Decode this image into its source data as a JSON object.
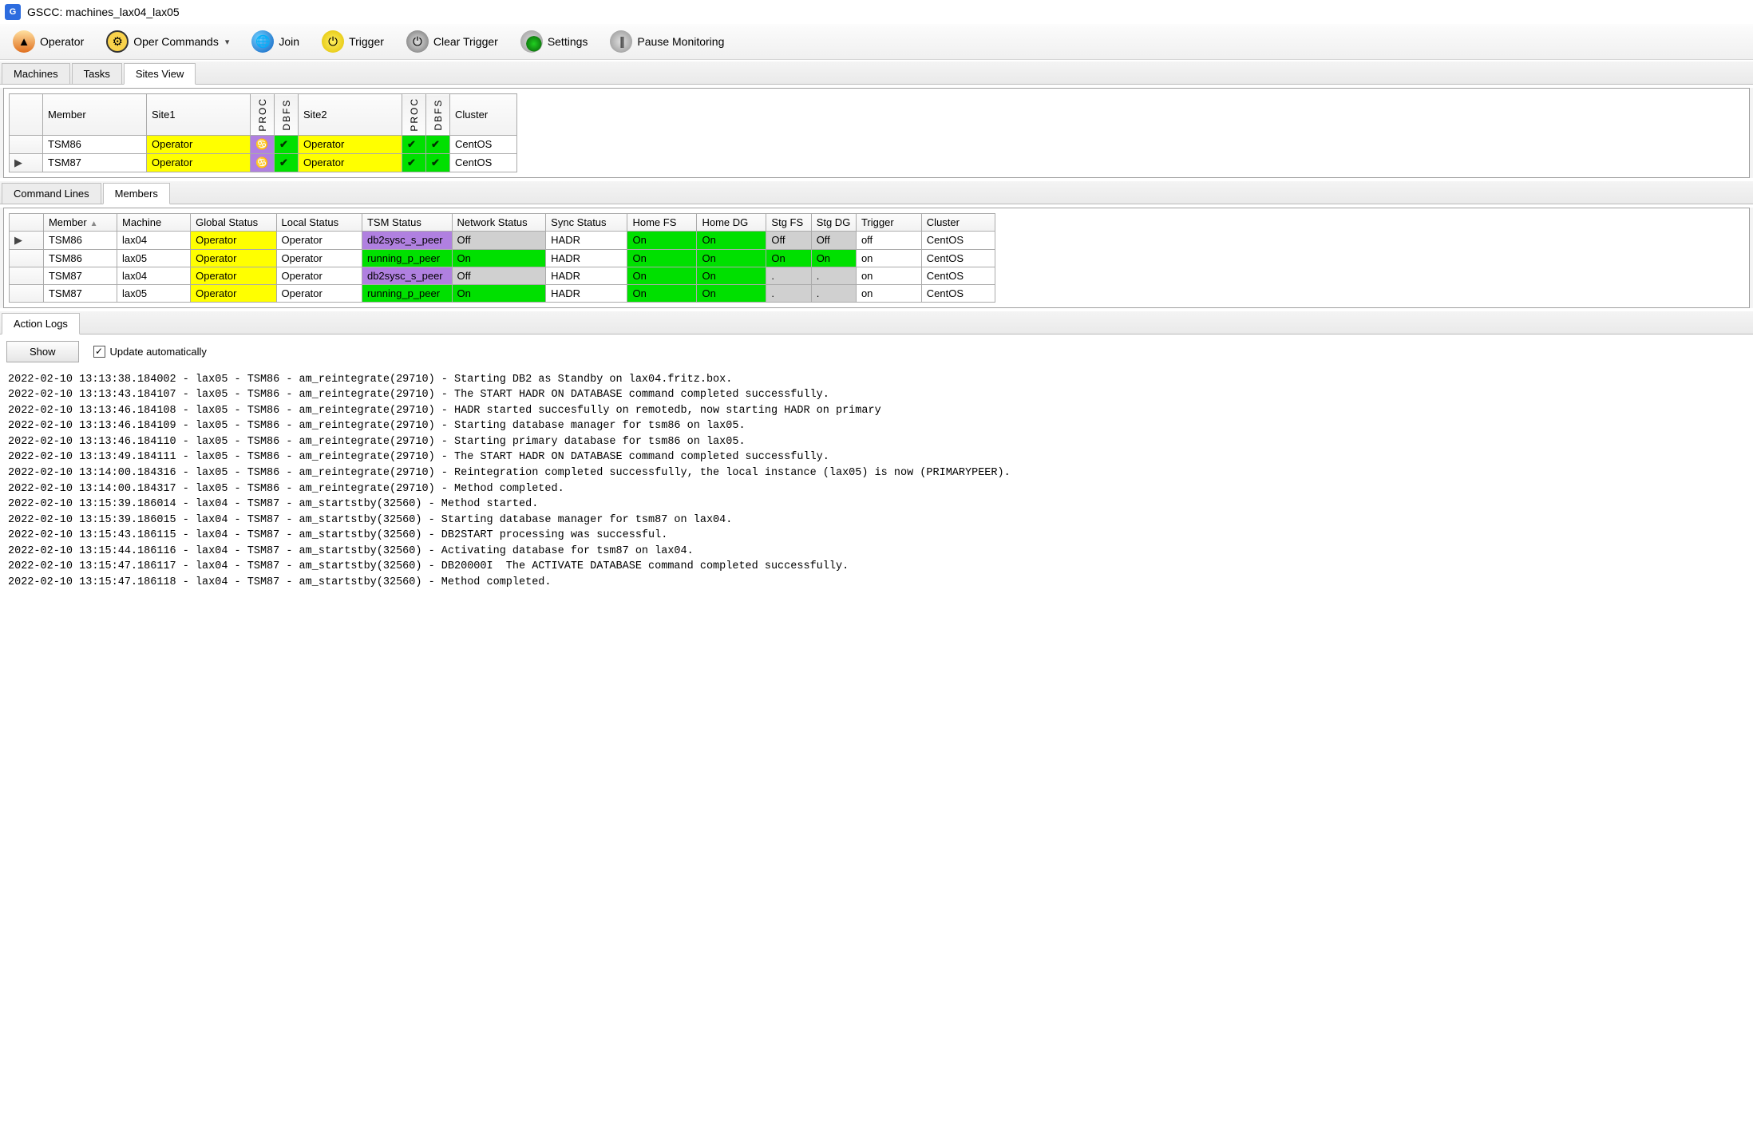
{
  "title": "GSCC: machines_lax04_lax05",
  "toolbar": {
    "operator": "Operator",
    "opercommands": "Oper Commands",
    "join": "Join",
    "trigger": "Trigger",
    "cleartrigger": "Clear Trigger",
    "settings": "Settings",
    "pause": "Pause Monitoring"
  },
  "tabs_top": {
    "machines": "Machines",
    "tasks": "Tasks",
    "sitesview": "Sites View"
  },
  "sites_headers": {
    "member": "Member",
    "site1": "Site1",
    "proc": "PROC",
    "dbfs": "DBFS",
    "site2": "Site2",
    "cluster": "Cluster"
  },
  "sites_rows": [
    {
      "sel": "",
      "member": "TSM86",
      "site1": "Operator",
      "proc1": "♋",
      "dbfs1": "✔",
      "site2": "Operator",
      "proc2": "✔",
      "dbfs2": "✔",
      "cluster": "CentOS"
    },
    {
      "sel": "▶",
      "member": "TSM87",
      "site1": "Operator",
      "proc1": "♋",
      "dbfs1": "✔",
      "site2": "Operator",
      "proc2": "✔",
      "dbfs2": "✔",
      "cluster": "CentOS"
    }
  ],
  "tabs_mid": {
    "commandlines": "Command Lines",
    "members": "Members"
  },
  "members_headers": {
    "member": "Member",
    "machine": "Machine",
    "global": "Global Status",
    "local": "Local Status",
    "tsm": "TSM Status",
    "network": "Network Status",
    "sync": "Sync Status",
    "homefs": "Home FS",
    "homedg": "Home DG",
    "stgfs": "Stg FS",
    "stgdg": "Stg DG",
    "trigger": "Trigger",
    "cluster": "Cluster"
  },
  "members_rows": [
    {
      "sel": "▶",
      "member": "TSM86",
      "machine": "lax04",
      "global": "Operator",
      "local": "Operator",
      "tsm": "db2sysc_s_peer",
      "tsm_c": "c-purple",
      "net": "Off",
      "net_c": "c-grey",
      "sync": "HADR",
      "homefs": "On",
      "homedg": "On",
      "stgfs": "Off",
      "stgfs_c": "c-grey",
      "stgdg": "Off",
      "stgdg_c": "c-grey",
      "trigger": "off",
      "cluster": "CentOS"
    },
    {
      "sel": "",
      "member": "TSM86",
      "machine": "lax05",
      "global": "Operator",
      "local": "Operator",
      "tsm": "running_p_peer",
      "tsm_c": "c-green",
      "net": "On",
      "net_c": "c-green",
      "sync": "HADR",
      "homefs": "On",
      "homedg": "On",
      "stgfs": "On",
      "stgfs_c": "c-green",
      "stgdg": "On",
      "stgdg_c": "c-green",
      "trigger": "on",
      "cluster": "CentOS"
    },
    {
      "sel": "",
      "member": "TSM87",
      "machine": "lax04",
      "global": "Operator",
      "local": "Operator",
      "tsm": "db2sysc_s_peer",
      "tsm_c": "c-purple",
      "net": "Off",
      "net_c": "c-grey",
      "sync": "HADR",
      "homefs": "On",
      "homedg": "On",
      "stgfs": ".",
      "stgfs_c": "c-grey",
      "stgdg": ".",
      "stgdg_c": "c-grey",
      "trigger": "on",
      "cluster": "CentOS"
    },
    {
      "sel": "",
      "member": "TSM87",
      "machine": "lax05",
      "global": "Operator",
      "local": "Operator",
      "tsm": "running_p_peer",
      "tsm_c": "c-green",
      "net": "On",
      "net_c": "c-green",
      "sync": "HADR",
      "homefs": "On",
      "homedg": "On",
      "stgfs": ".",
      "stgfs_c": "c-grey",
      "stgdg": ".",
      "stgdg_c": "c-grey",
      "trigger": "on",
      "cluster": "CentOS"
    }
  ],
  "tabs_bottom": {
    "actionlogs": "Action Logs"
  },
  "show_btn": "Show",
  "update_auto": "Update automatically",
  "log_lines": [
    "2022-02-10 13:13:38.184002 - lax05 - TSM86 - am_reintegrate(29710) - Starting DB2 as Standby on lax04.fritz.box.",
    "2022-02-10 13:13:43.184107 - lax05 - TSM86 - am_reintegrate(29710) - The START HADR ON DATABASE command completed successfully.",
    "2022-02-10 13:13:46.184108 - lax05 - TSM86 - am_reintegrate(29710) - HADR started succesfully on remotedb, now starting HADR on primary",
    "2022-02-10 13:13:46.184109 - lax05 - TSM86 - am_reintegrate(29710) - Starting database manager for tsm86 on lax05.",
    "2022-02-10 13:13:46.184110 - lax05 - TSM86 - am_reintegrate(29710) - Starting primary database for tsm86 on lax05.",
    "2022-02-10 13:13:49.184111 - lax05 - TSM86 - am_reintegrate(29710) - The START HADR ON DATABASE command completed successfully.",
    "2022-02-10 13:14:00.184316 - lax05 - TSM86 - am_reintegrate(29710) - Reintegration completed successfully, the local instance (lax05) is now (PRIMARYPEER).",
    "2022-02-10 13:14:00.184317 - lax05 - TSM86 - am_reintegrate(29710) - Method completed.",
    "2022-02-10 13:15:39.186014 - lax04 - TSM87 - am_startstby(32560) - Method started.",
    "2022-02-10 13:15:39.186015 - lax04 - TSM87 - am_startstby(32560) - Starting database manager for tsm87 on lax04.",
    "2022-02-10 13:15:43.186115 - lax04 - TSM87 - am_startstby(32560) - DB2START processing was successful.",
    "2022-02-10 13:15:44.186116 - lax04 - TSM87 - am_startstby(32560) - Activating database for tsm87 on lax04.",
    "2022-02-10 13:15:47.186117 - lax04 - TSM87 - am_startstby(32560) - DB20000I  The ACTIVATE DATABASE command completed successfully.",
    "2022-02-10 13:15:47.186118 - lax04 - TSM87 - am_startstby(32560) - Method completed."
  ]
}
